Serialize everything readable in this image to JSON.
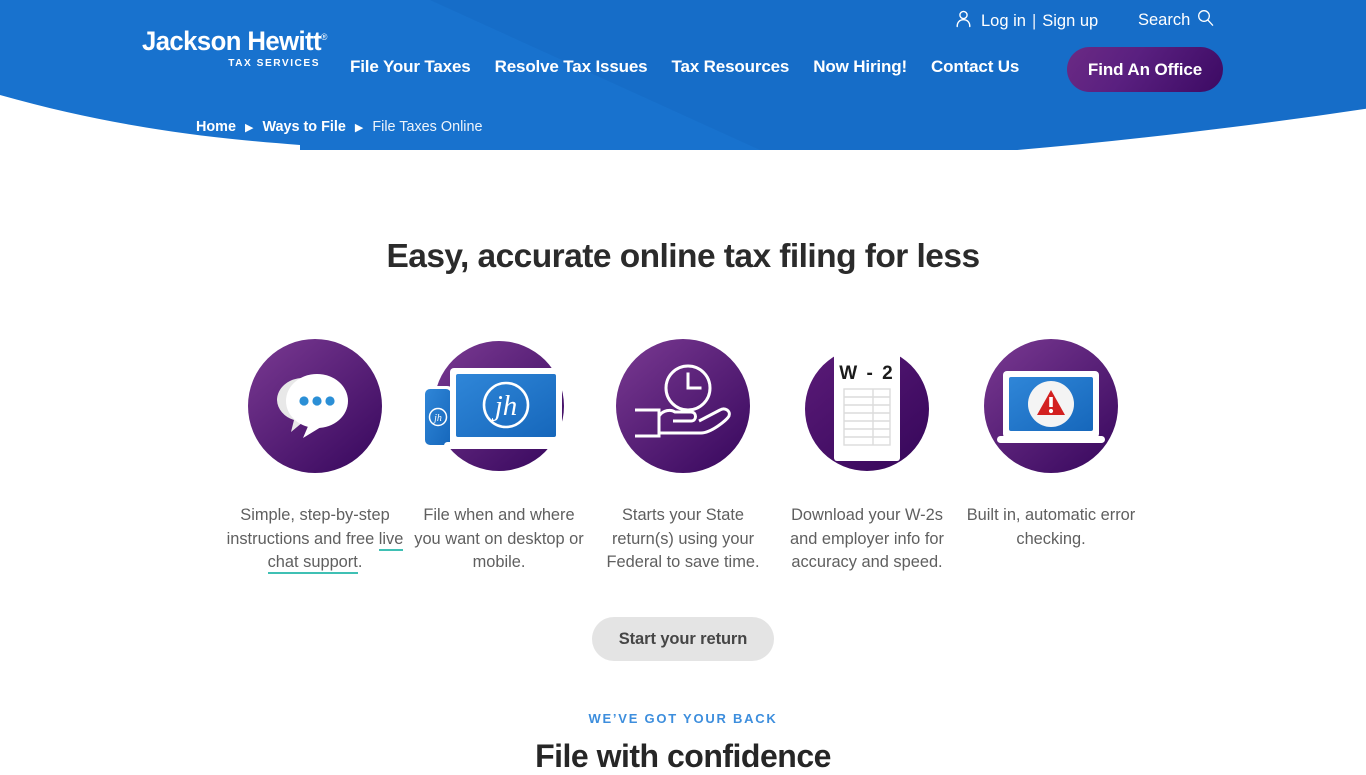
{
  "header": {
    "brand": {
      "name_line1": "Jackson Hewitt",
      "registered_mark": "®",
      "tagline": "TAX SERVICES"
    },
    "utility": {
      "person_icon": "person-icon",
      "login_label": "Log in",
      "separator": "|",
      "signup_label": "Sign up",
      "search_label": "Search",
      "search_icon": "magnifier-icon"
    },
    "nav_items": [
      {
        "label": "File Your Taxes"
      },
      {
        "label": "Resolve Tax Issues"
      },
      {
        "label": "Tax Resources"
      },
      {
        "label": "Now Hiring!"
      },
      {
        "label": "Contact Us"
      }
    ],
    "cta_label": "Find An Office",
    "colors": {
      "header_blue": "#1872ce",
      "cta_gradient_start": "#6b2a84",
      "cta_gradient_end": "#3c0a63"
    }
  },
  "breadcrumb": {
    "items": [
      {
        "label": "Home",
        "current": false
      },
      {
        "label": "Ways to File",
        "current": false
      },
      {
        "label": "File Taxes Online",
        "current": true
      }
    ],
    "separator": "▶"
  },
  "main": {
    "headline": "Easy, accurate online tax filing for less",
    "features": [
      {
        "icon": "chat-bubbles-icon",
        "caption_prefix": "Simple, step-by-step instructions and free ",
        "caption_link": "live chat support",
        "caption_suffix": "."
      },
      {
        "icon": "devices-phone-laptop-icon",
        "caption": "File when and where you want on desktop or mobile."
      },
      {
        "icon": "hand-holding-clock-icon",
        "caption": "Starts your State return(s) using your Federal to save time."
      },
      {
        "icon": "w2-document-icon",
        "caption": "Download your W-2s and employer info for accuracy and speed.",
        "doc_label": "W - 2"
      },
      {
        "icon": "laptop-error-alert-icon",
        "caption": "Built in, automatic error checking."
      }
    ],
    "start_button_label": "Start your return",
    "eyebrow": "WE’VE GOT YOUR BACK",
    "subheadline": "File with confidence",
    "colors": {
      "link_underline": "#3fc0b4",
      "eyebrow_blue": "#3d8edd",
      "icon_purple_light": "#7a3a92",
      "icon_purple_dark": "#3b0a60",
      "screen_blue": "#1f7ad1",
      "alert_red": "#d32020"
    }
  }
}
